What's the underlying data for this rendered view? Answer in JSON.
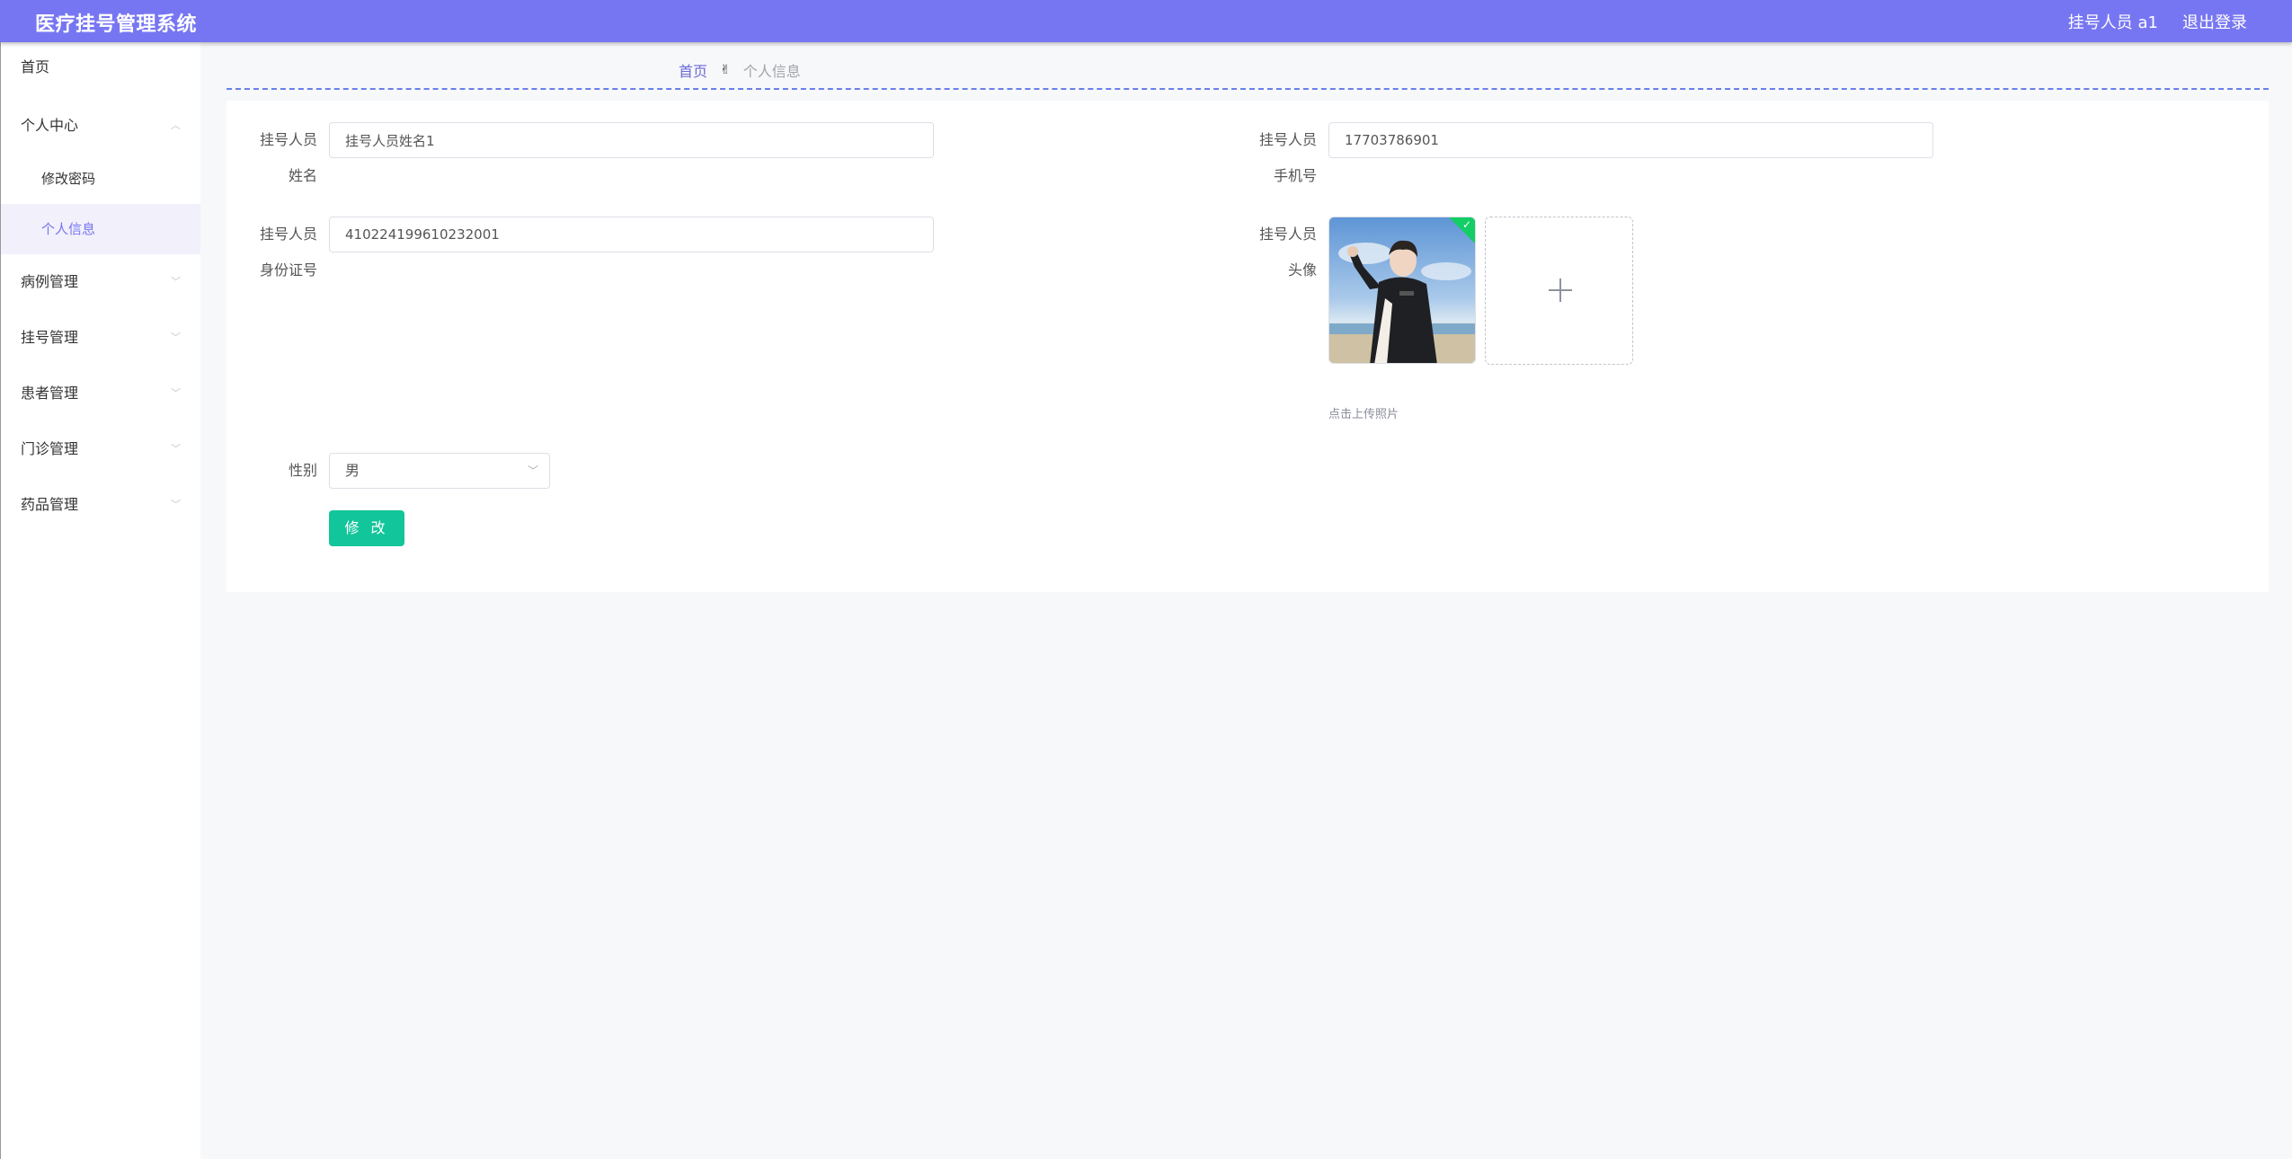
{
  "header": {
    "title": "医疗挂号管理系统",
    "user_label": "挂号人员 a1",
    "logout_label": "退出登录"
  },
  "sidebar": {
    "items": [
      {
        "label": "首页"
      },
      {
        "label": "个人中心"
      },
      {
        "label": "修改密码"
      },
      {
        "label": "个人信息"
      },
      {
        "label": "病例管理"
      },
      {
        "label": "挂号管理"
      },
      {
        "label": "患者管理"
      },
      {
        "label": "门诊管理"
      },
      {
        "label": "药品管理"
      }
    ]
  },
  "breadcrumb": {
    "home": "首页",
    "current": "个人信息"
  },
  "form": {
    "name": {
      "label_line1": "挂号人员",
      "label_line2": "姓名",
      "value": "挂号人员姓名1"
    },
    "phone": {
      "label_line1": "挂号人员",
      "label_line2": "手机号",
      "value": "17703786901"
    },
    "id_card": {
      "label_line1": "挂号人员",
      "label_line2": "身份证号",
      "value": "410224199610232001"
    },
    "avatar": {
      "label_line1": "挂号人员",
      "label_line2": "头像",
      "upload_tip": "点击上传照片"
    },
    "gender": {
      "label": "性别",
      "value": "男"
    },
    "submit_label": "修 改"
  },
  "colors": {
    "header_bg": "#7776f2",
    "active_menu": "#7776f2",
    "submit_btn": "#13c59a",
    "success_badge": "#13ce66"
  }
}
